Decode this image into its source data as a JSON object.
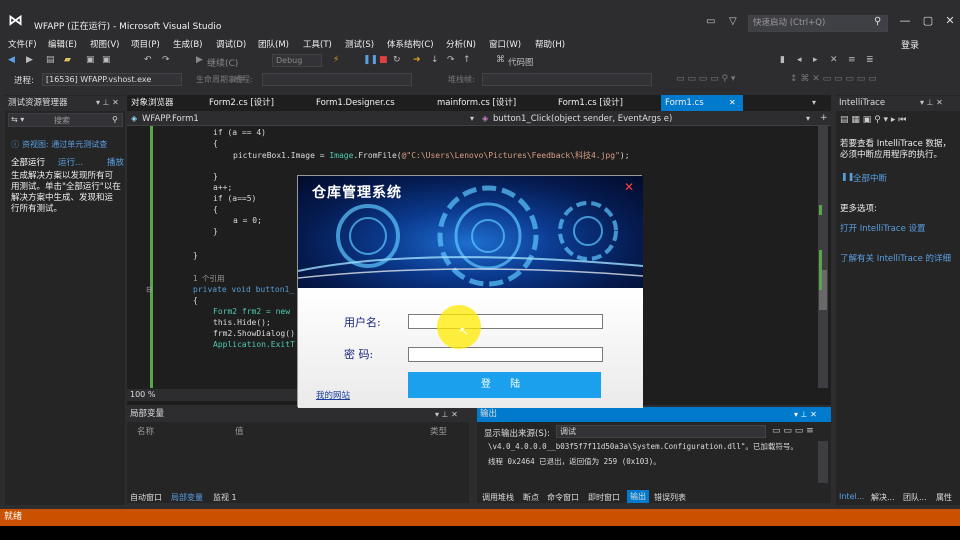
{
  "window": {
    "title": "WFAPP (正在运行) - Microsoft Visual Studio",
    "quick_launch": "快速启动 (Ctrl+Q)",
    "login": "登录"
  },
  "menu": [
    "文件(F)",
    "编辑(E)",
    "视图(V)",
    "项目(P)",
    "生成(B)",
    "调试(D)",
    "团队(M)",
    "工具(T)",
    "测试(S)",
    "体系结构(C)",
    "分析(N)",
    "窗口(W)",
    "帮助(H)"
  ],
  "toolbar": {
    "config": "Debug",
    "continue": "继续(C)",
    "code_map": "代码图",
    "process_label": "进程:",
    "process": "[16536] WFAPP.vshost.exe",
    "lifecycle": "生命周期事件",
    "thread": "线程:",
    "stackframe": "堆栈帧:"
  },
  "left_panel": {
    "title": "测试资源管理器",
    "search": "搜索",
    "info": "资视图: 通过单元测试查",
    "run_all": "全部运行",
    "run": "运行...",
    "playlist": "播放",
    "message": "生成解决方案以发现所有可用测试。单击\"全部运行\"以在解决方案中生成、发现和运行所有测试。"
  },
  "tabs": [
    "对象浏览器",
    "Form2.cs [设计]",
    "Form1.Designer.cs",
    "mainform.cs [设计]",
    "Form1.cs [设计]",
    "Form1.cs"
  ],
  "nav": {
    "left": "WFAPP.Form1",
    "right": "button1_Click(object sender, EventArgs e)"
  },
  "code": {
    "l1": "if (a == 4)",
    "l2": "{",
    "l3a": "pictureBox1.Image = ",
    "l3b": "Image",
    "l3c": ".FromFile(",
    "l3d": "@\"C:\\Users\\Lenovo\\Pictures\\Feedback\\科技4.jpg\"",
    "l3e": ");",
    "l4": "}",
    "l5": "a++;",
    "l6": "if (a==5)",
    "l7": "{",
    "l8": "a = 0;",
    "l9": "}",
    "l10": "}",
    "refs": "1 个引用",
    "sig": "private void button1_",
    "l11": "{",
    "l12": "Form2 frm2 = new",
    "l13": "this.Hide();",
    "l14": "frm2.ShowDialog()",
    "l15": "Application.ExitT"
  },
  "zoom": "100 %",
  "locals": {
    "title": "局部变量",
    "col_name": "名称",
    "col_value": "值",
    "col_type": "类型",
    "tabs": [
      "自动窗口",
      "局部变量",
      "监视 1"
    ]
  },
  "output": {
    "title": "输出",
    "source_label": "显示输出来源(S):",
    "source": "调试",
    "line1": "\\v4.0_4.0.0.0__b03f5f7f11d50a3a\\System.Configuration.dll\"。已加载符号。",
    "line2": "线程 0x2464 已退出，返回值为 259 (0x103)。",
    "tabs": [
      "调用堆栈",
      "断点",
      "命令窗口",
      "即时窗口",
      "输出",
      "错误列表"
    ]
  },
  "right_panel": {
    "title": "IntelliTrace",
    "msg": "若要查看 IntelliTrace 数据，必须中断应用程序的执行。",
    "break_all": "全部中断",
    "more": "更多选项:",
    "open_settings": "打开 IntelliTrace 设置",
    "learn": "了解有关 IntelliTrace 的详细",
    "tabs": [
      "Intel...",
      "解决...",
      "团队...",
      "属性"
    ]
  },
  "dialog": {
    "title": "仓库管理系统",
    "user_label": "用户名:",
    "pwd_label": "密    码:",
    "login_button": "登 陆",
    "home_link": "我的网站"
  },
  "status": "就绪"
}
